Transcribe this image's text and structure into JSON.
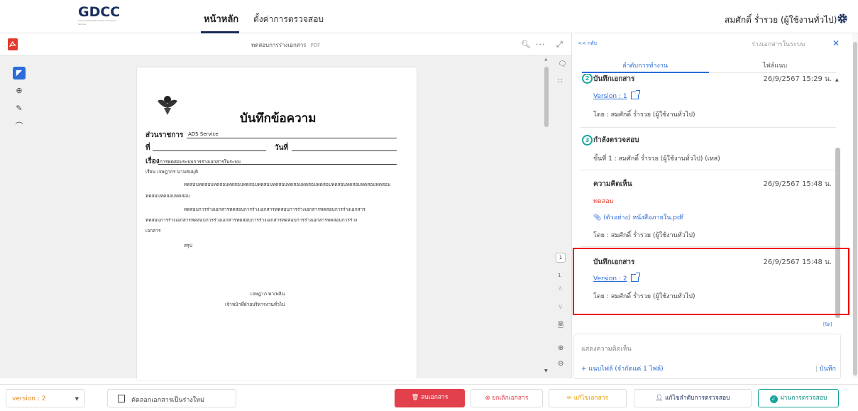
{
  "header": {
    "logo_text": "GDCC",
    "logo_sub": "Government Data Center and Cloud Service",
    "nav": [
      {
        "label": "หน้าหลัก"
      },
      {
        "label": "ตั้งค่าการตรวจสอบ"
      }
    ],
    "user": "สมศักดิ์ ร่ำรวย (ผู้ใช้งานทั่วไป)",
    "icons": {
      "settings": "gear-icon"
    }
  },
  "pdf_viewer": {
    "file_name": "ทดสอบการร่างเอกสาร",
    "file_ext": "PDF",
    "page_number": "1",
    "page_total": "1",
    "icons": {
      "file": "pdf-icon",
      "search": "search-icon",
      "more": "more-icon",
      "expand": "expand-icon"
    },
    "doc": {
      "title": "บันทึกข้อความ",
      "agency_label": "ส่วนราชการ",
      "agency_value": "ADS Service",
      "no_label": "ที่",
      "date_label": "วันที่",
      "subject_label": "เรื่อง",
      "subject_value": "การทดสอบระบบการร่างเอกสารในระบบ",
      "to_line": "เรียน  เจษฎากร นามสมมุติ",
      "para1a": "ทดสอบทดสอบทดสอบทดสอบทดสอบทดสอบทดสอบทดสอบทดสอบทดสอบทดสอบทดสอบทดสอบทดสอบ",
      "para1b": "ทดสอบทดสอบทดสอบ",
      "para2a": "ทดสอบการร่างเอกสารทดสอบการร่างเอกสารทดสอบการร่างเอกสารทดสอบการร่างเอกสาร",
      "para2b": "ทดสอบการร่างเอกสารทดสอบการร่างเอกสารทดสอบการร่างเอกสารทดสอบการร่างเอกสารทดสอบการร่าง",
      "para2c": "เอกสาร",
      "summary": "สรุป",
      "signer": "เจษฎาภ พาเพลิน",
      "position": "เจ้าหน้าที่ฝ่ายบริหารงานทั่วไป"
    }
  },
  "sidebar": {
    "back_label": "<< กลับ",
    "draft_label": "ร่างเอกสารในระบบ",
    "tabs": [
      {
        "label": "ลำดับการทำงาน"
      },
      {
        "label": "ไฟล์แนบ"
      }
    ],
    "entries": [
      {
        "step": "2",
        "title": "บันทึกเอกสาร",
        "time": "26/9/2567 15:29 น.",
        "version": "Version : 1",
        "by": "โดย : สมศักดิ์ ร่ำรวย (ผู้ใช้งานทั่วไป)"
      },
      {
        "step": "3",
        "title": "กำลังตรวจสอบ",
        "detail": "ขั้นที่ 1 : สมศักดิ์ ร่ำรวย (ผู้ใช้งานทั่วไป) (เทส)"
      },
      {
        "title": "ความคิดเห็น",
        "time": "26/9/2567 15:48 น.",
        "comment": "ทดสอบ",
        "attachment": "(ตัวอย่าง) หนังสือภายใน.pdf",
        "by": "โดย : สมศักดิ์ ร่ำรวย (ผู้ใช้งานทั่วไป)"
      },
      {
        "title": "บันทึกเอกสาร",
        "time": "26/9/2567 15:48 น.",
        "version": "Version : 2",
        "by": "โดย : สมศักดิ์ ร่ำรวย (ผู้ใช้งานทั่วไป)"
      }
    ],
    "close_label": "[ปิด]",
    "comment_placeholder": "แสดงความคิดเห็น",
    "attach_label": "แนบไฟล์ (จำกัดแค่ 1 ไฟล์)",
    "save_label": "บันทึก"
  },
  "footer": {
    "version_select": "version : 2",
    "copy_button": "คัดลอกเอกสารเป็นร่างใหม่",
    "buttons": {
      "delete": "ลบเอกสาร",
      "cancel": "ยกเลิกเอกสาร",
      "edit": "แก้ไขเอกสาร",
      "edit_flow": "แก้ไขลำดับการตรวจสอบ",
      "pass": "ผ่านการตรวจสอบ"
    },
    "colors": {
      "danger": "#e2404c",
      "warning": "#e8a000",
      "success": "#1aa59c",
      "primary": "#2b6cd8"
    }
  }
}
